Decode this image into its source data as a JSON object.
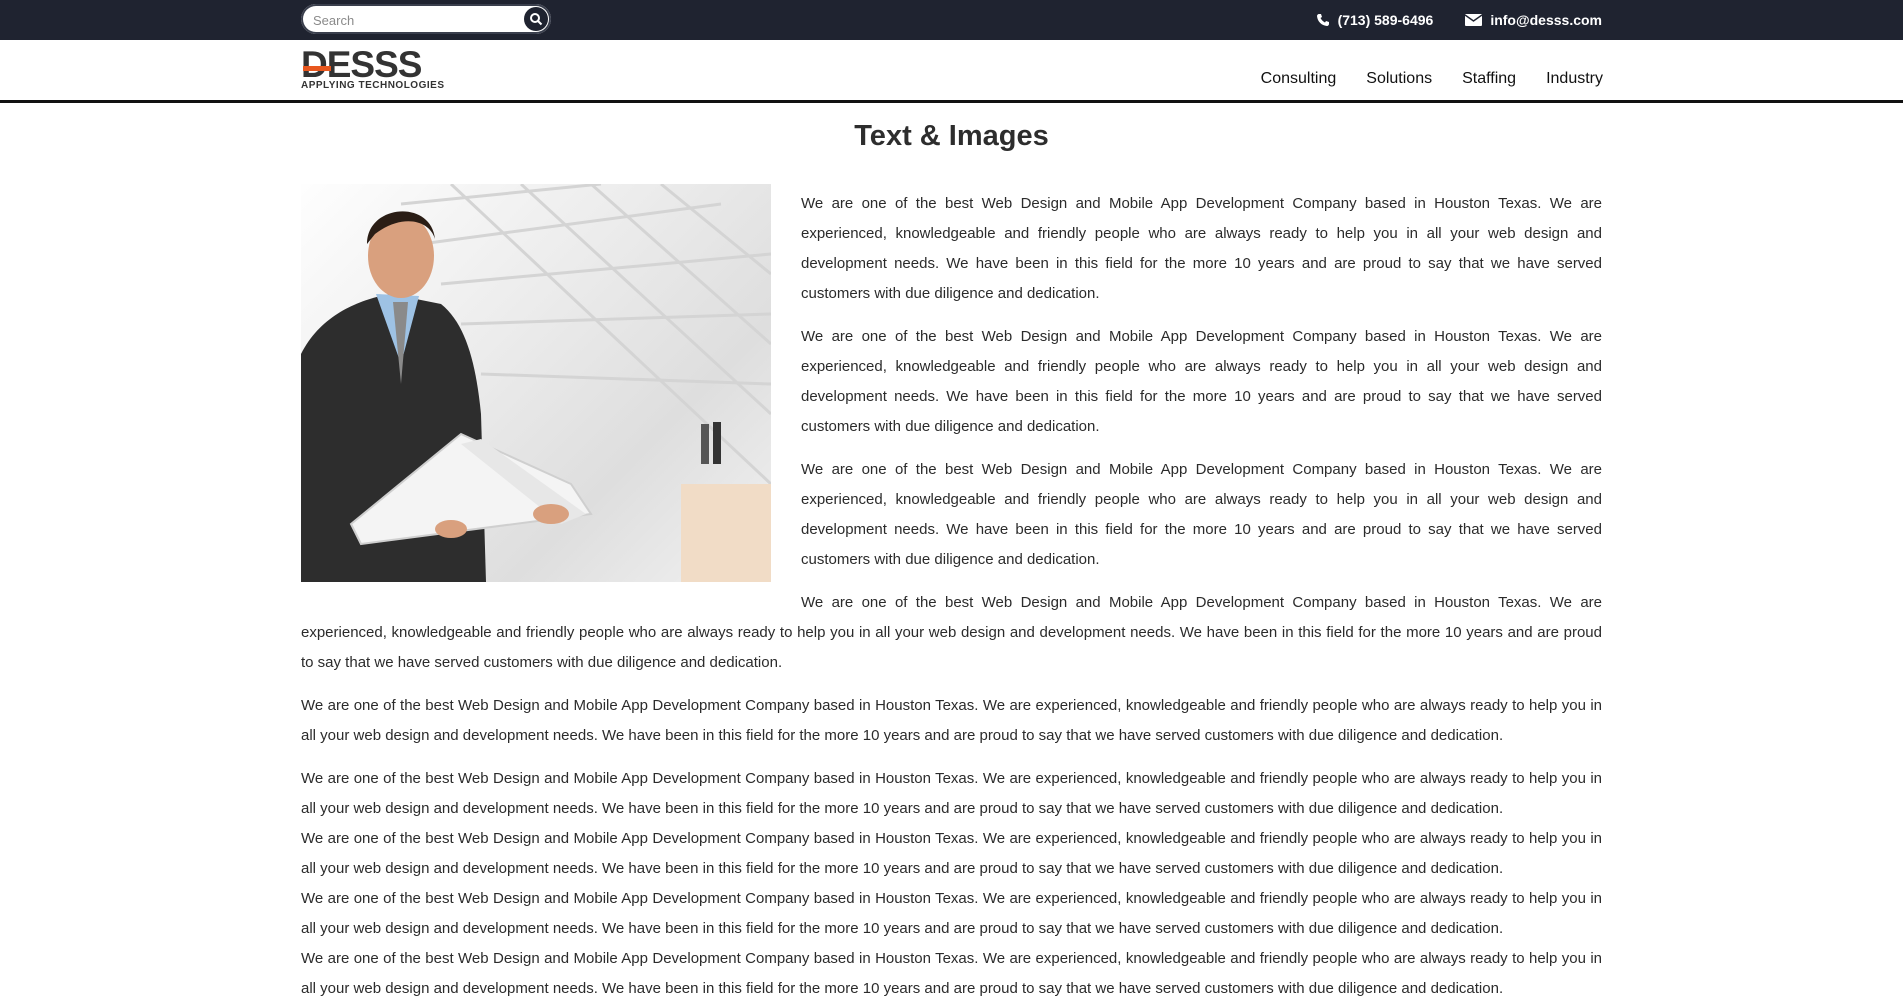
{
  "topbar": {
    "search_placeholder": "Search",
    "phone": "(713) 589-6496",
    "email": "info@desss.com"
  },
  "header": {
    "logo_text": "DESSS",
    "logo_tagline": "APPLYING TECHNOLOGIES",
    "nav": [
      "Consulting",
      "Solutions",
      "Staffing",
      "Industry"
    ]
  },
  "main": {
    "title": "Text & Images",
    "paragraph": "We are one of the best Web Design and Mobile App Development Company based in Houston Texas. We are experienced, knowledgeable and friendly people who are always ready to help you in all your web design and development needs. We have been in this field for the more 10 years and are proud to say that we have served customers with due diligence and dedication."
  },
  "colors": {
    "topbar_bg": "#1f2330",
    "accent_orange": "#e8571e"
  }
}
